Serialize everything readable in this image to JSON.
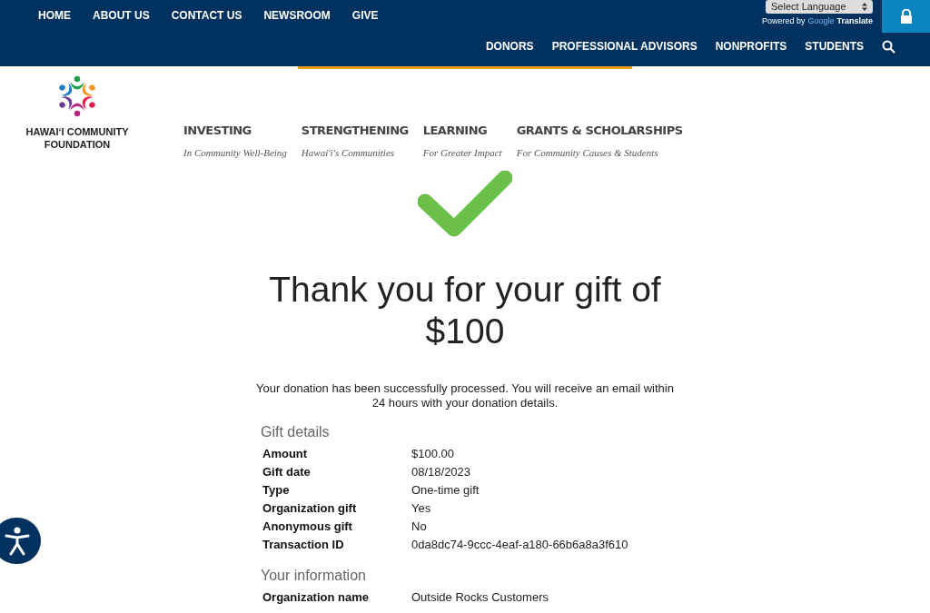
{
  "top_nav": [
    "HOME",
    "ABOUT US",
    "CONTACT US",
    "NEWSROOM",
    "GIVE"
  ],
  "language": {
    "value": "Select Language",
    "powered_by": "Powered by",
    "google": "Google",
    "translate": "Translate"
  },
  "audience_nav": [
    "DONORS",
    "PROFESSIONAL ADVISORS",
    "NONPROFITS",
    "STUDENTS"
  ],
  "logo": {
    "line1": "HAWAIʻI COMMUNITY",
    "line2": "FOUNDATION"
  },
  "main_nav": [
    {
      "title": "INVESTING",
      "subtitle": "In Community Well-Being"
    },
    {
      "title": "STRENGTHENING",
      "subtitle": "Hawai'i's Communities"
    },
    {
      "title": "LEARNING",
      "subtitle": "For Greater Impact"
    },
    {
      "title": "GRANTS & SCHOLARSHIPS",
      "subtitle": "For Community Causes & Students"
    }
  ],
  "heading": "Thank you for your gift of $100",
  "message": "Your donation has been successfully processed. You will receive an email within 24 hours with your donation details.",
  "sections": [
    {
      "title": "Gift details",
      "rows": [
        {
          "label": "Amount",
          "value": "$100.00"
        },
        {
          "label": "Gift date",
          "value": "08/18/2023"
        },
        {
          "label": "Type",
          "value": "One-time gift"
        },
        {
          "label": "Organization gift",
          "value": "Yes"
        },
        {
          "label": "Anonymous gift",
          "value": "No"
        },
        {
          "label": "Transaction ID",
          "value": "0da8dc74-9ccc-4eaf-a180-66b6a8a3f610"
        }
      ]
    },
    {
      "title": "Your information",
      "rows": [
        {
          "label": "Organization name",
          "value": "Outside Rocks Customers"
        }
      ]
    }
  ]
}
